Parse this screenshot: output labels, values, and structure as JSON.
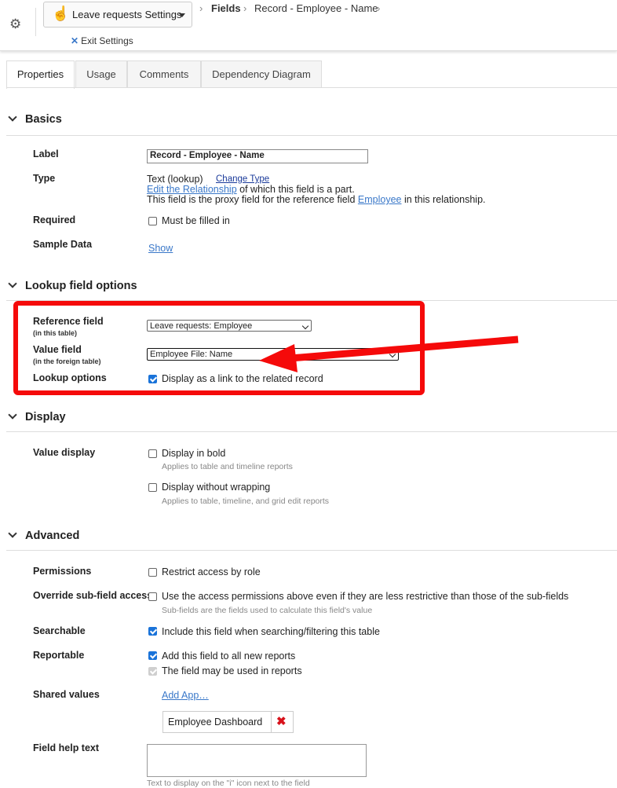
{
  "header": {
    "app_button_label": "Leave requests Settings",
    "breadcrumbs": [
      "Fields",
      "Record - Employee - Name"
    ],
    "exit_label": "Exit Settings"
  },
  "tabs": [
    {
      "label": "Properties",
      "active": true
    },
    {
      "label": "Usage",
      "active": false
    },
    {
      "label": "Comments",
      "active": false
    },
    {
      "label": "Dependency Diagram",
      "active": false
    }
  ],
  "basics": {
    "title": "Basics",
    "label_label": "Label",
    "label_value": "Record - Employee - Name",
    "type_label": "Type",
    "type_value": "Text (lookup)",
    "change_type": "Change Type",
    "edit_relationship": "Edit the Relationship",
    "edit_relationship_suffix": "of which this field is a part.",
    "proxy_prefix": "This field is the proxy field for the reference field",
    "proxy_link": "Employee",
    "proxy_suffix": "in this relationship.",
    "required_label": "Required",
    "required_text": "Must be filled in",
    "sample_label": "Sample Data",
    "sample_link": "Show"
  },
  "lookup": {
    "title": "Lookup field options",
    "reference_label": "Reference field",
    "reference_sub": "(in this table)",
    "reference_value": "Leave requests: Employee",
    "value_label": "Value field",
    "value_sub": "(in the foreign table)",
    "value_value": "Employee File: Name",
    "options_label": "Lookup options",
    "options_text": "Display as a link to the related record"
  },
  "display": {
    "title": "Display",
    "value_display_label": "Value display",
    "bold_text": "Display in bold",
    "bold_hint": "Applies to table and timeline reports",
    "nowrap_text": "Display without wrapping",
    "nowrap_hint": "Applies to table, timeline, and grid edit reports"
  },
  "advanced": {
    "title": "Advanced",
    "permissions_label": "Permissions",
    "permissions_text": "Restrict access by role",
    "override_label": "Override sub-field access",
    "override_text": "Use the access permissions above even if they are less restrictive than those of the sub-fields",
    "override_hint": "Sub-fields are the fields used to calculate this field's value",
    "searchable_label": "Searchable",
    "searchable_text": "Include this field when searching/filtering this table",
    "reportable_label": "Reportable",
    "reportable_text1": "Add this field to all new reports",
    "reportable_text2": "The field may be used in reports",
    "shared_label": "Shared values",
    "add_app": "Add App…",
    "shared_app": "Employee Dashboard",
    "help_label": "Field help text",
    "help_hint": "Text to display on the \"i\" icon next to the field"
  },
  "colors": {
    "accent": "#1a73d9",
    "highlight": "#f50a0a",
    "link": "#3a78c9"
  }
}
